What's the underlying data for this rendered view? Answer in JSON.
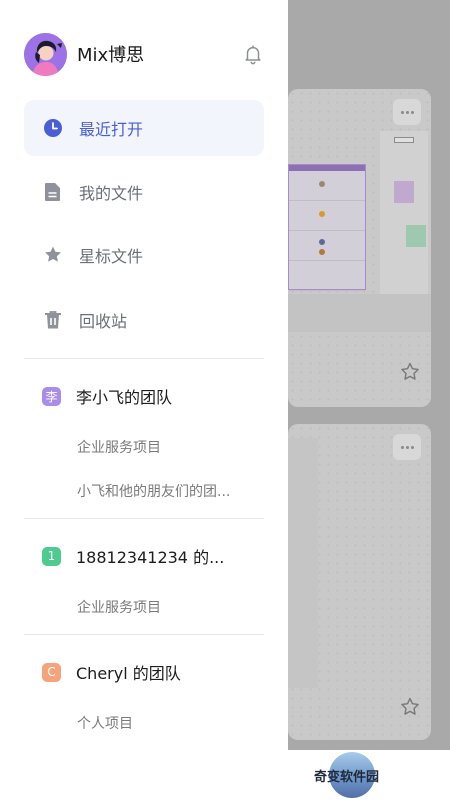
{
  "profile": {
    "name": "Mix博思"
  },
  "nav": [
    {
      "label": "最近打开",
      "icon": "clock-icon",
      "active": true
    },
    {
      "label": "我的文件",
      "icon": "file-icon",
      "active": false
    },
    {
      "label": "星标文件",
      "icon": "star-icon",
      "active": false
    },
    {
      "label": "回收站",
      "icon": "trash-icon",
      "active": false
    }
  ],
  "teams": [
    {
      "badge": "李",
      "color": "#a98ee9",
      "name": "李小飞的团队",
      "projects": [
        "企业服务项目",
        "小飞和他的朋友们的团..."
      ]
    },
    {
      "badge": "1",
      "color": "#4ecb8f",
      "name": "18812341234 的...",
      "projects": [
        "企业服务项目"
      ]
    },
    {
      "badge": "C",
      "color": "#f5a37a",
      "name": "Cheryl 的团队",
      "projects": [
        "个人项目"
      ]
    }
  ],
  "watermark": {
    "text": "奇变软件园"
  },
  "colors": {
    "accent": "#4a5fd6",
    "active_bg": "#f3f5fd",
    "overlay": "#a9a9a9"
  }
}
